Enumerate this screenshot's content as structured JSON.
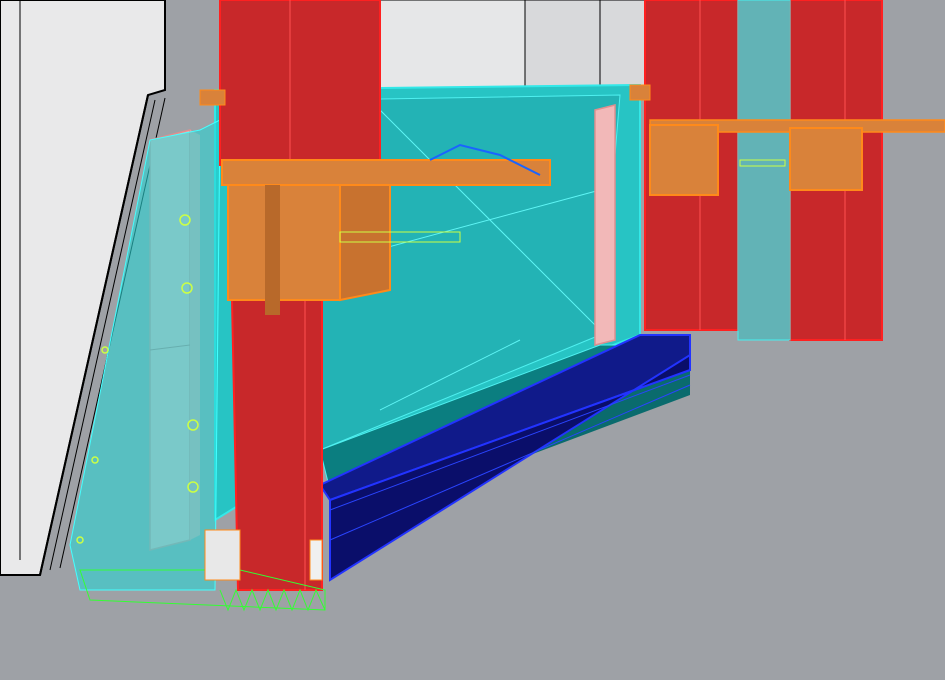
{
  "viewport": {
    "background": "#9ea1a6",
    "render_mode": "shaded-wireframe",
    "projection": "perspective"
  },
  "model": {
    "components": [
      {
        "name": "red-steel-column",
        "color": "#c8282a"
      },
      {
        "name": "orange-bracket",
        "color": "#d9823a"
      },
      {
        "name": "cyan-glass-panel",
        "color": "#27c4c4"
      },
      {
        "name": "pink-fin",
        "color": "#f2b8b8"
      },
      {
        "name": "blue-channel",
        "color": "#101a8a"
      },
      {
        "name": "white-wall",
        "color": "#e9e9ea"
      }
    ]
  }
}
